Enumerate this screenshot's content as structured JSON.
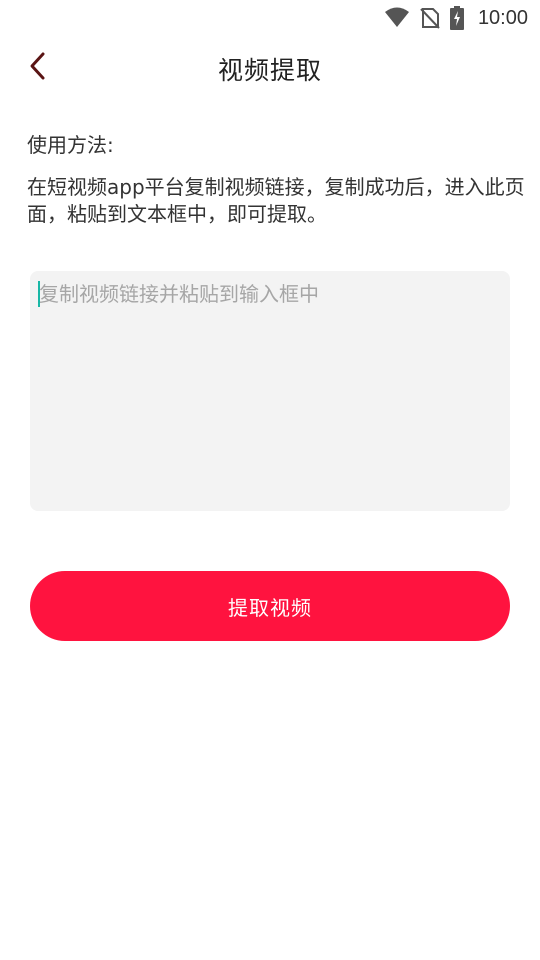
{
  "status_bar": {
    "time": "10:00",
    "icons": [
      "wifi-icon",
      "no-sim-icon",
      "battery-charging-icon"
    ]
  },
  "toolbar": {
    "back_icon": "chevron-left-icon",
    "title": "视频提取"
  },
  "instructions": {
    "label": "使用方法:",
    "text": "在短视频app平台复制视频链接，复制成功后，进入此页面，粘贴到文本框中，即可提取。"
  },
  "link_input": {
    "value": "",
    "placeholder": "复制视频链接并粘贴到输入框中"
  },
  "extract_button": {
    "label": "提取视频"
  },
  "colors": {
    "accent": "#ff133f",
    "back_icon": "#5a1414",
    "input_background": "#f3f3f3",
    "placeholder": "#a6a6a6",
    "caret": "#18b7a6"
  }
}
